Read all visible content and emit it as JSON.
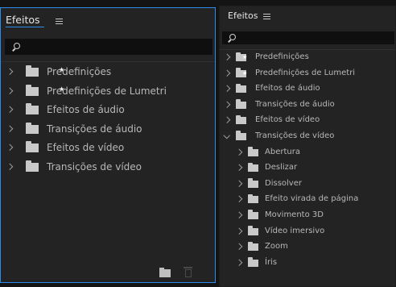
{
  "left_panel": {
    "title": "Efeitos",
    "items": [
      {
        "label": "Predefinições",
        "icon": "preset-folder-icon"
      },
      {
        "label": "Predefinições de Lumetri",
        "icon": "preset-folder-icon"
      },
      {
        "label": "Efeitos de áudio",
        "icon": "folder-icon"
      },
      {
        "label": "Transições de áudio",
        "icon": "folder-icon"
      },
      {
        "label": "Efeitos de vídeo",
        "icon": "folder-icon"
      },
      {
        "label": "Transições de vídeo",
        "icon": "folder-icon"
      }
    ]
  },
  "right_panel": {
    "title": "Efeitos",
    "items": [
      {
        "label": "Predefinições",
        "icon": "preset-folder-icon",
        "expanded": false,
        "level": 0
      },
      {
        "label": "Predefinições de Lumetri",
        "icon": "preset-folder-icon",
        "expanded": false,
        "level": 0
      },
      {
        "label": "Efeitos de áudio",
        "icon": "folder-icon",
        "expanded": false,
        "level": 0
      },
      {
        "label": "Transições de áudio",
        "icon": "folder-icon",
        "expanded": false,
        "level": 0
      },
      {
        "label": "Efeitos de vídeo",
        "icon": "folder-icon",
        "expanded": false,
        "level": 0
      },
      {
        "label": "Transições de vídeo",
        "icon": "folder-icon",
        "expanded": true,
        "level": 0
      },
      {
        "label": "Abertura",
        "icon": "folder-icon",
        "expanded": false,
        "level": 1
      },
      {
        "label": "Deslizar",
        "icon": "folder-icon",
        "expanded": false,
        "level": 1
      },
      {
        "label": "Dissolver",
        "icon": "folder-icon",
        "expanded": false,
        "level": 1
      },
      {
        "label": "Efeito virada de página",
        "icon": "folder-icon",
        "expanded": false,
        "level": 1
      },
      {
        "label": "Movimento 3D",
        "icon": "folder-icon",
        "expanded": false,
        "level": 1
      },
      {
        "label": "Vídeo imersivo",
        "icon": "folder-icon",
        "expanded": false,
        "level": 1
      },
      {
        "label": "Zoom",
        "icon": "folder-icon",
        "expanded": false,
        "level": 1
      },
      {
        "label": "Íris",
        "icon": "folder-icon",
        "expanded": false,
        "level": 1
      }
    ]
  },
  "colors": {
    "accent": "#2d8ceb",
    "panel_bg": "#232323",
    "search_bg": "#0f0f0f",
    "text": "#b8b8b8"
  }
}
